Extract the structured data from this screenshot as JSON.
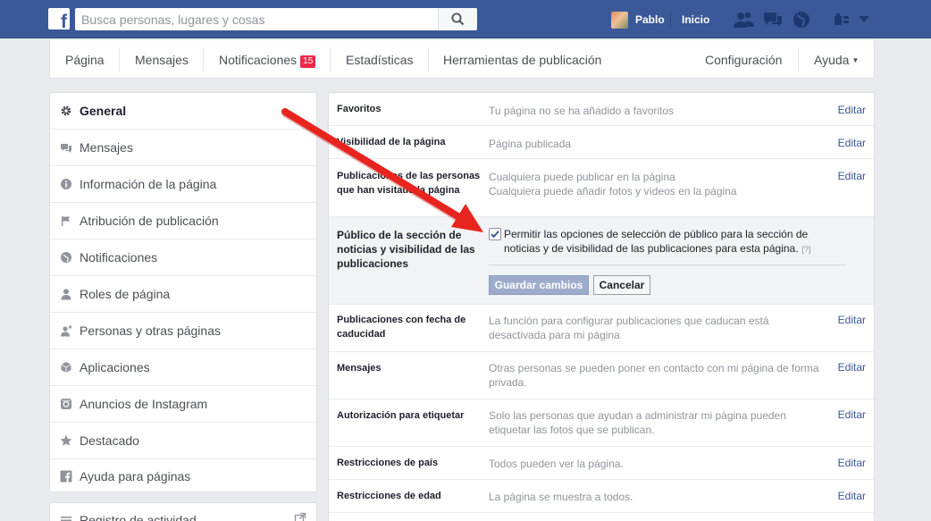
{
  "topbar": {
    "logo_letter": "f",
    "search_placeholder": "Busca personas, lugares y cosas",
    "user_name": "Pablo",
    "home_label": "Inicio"
  },
  "nav": {
    "pagina": "Página",
    "mensajes": "Mensajes",
    "notificaciones": "Notificaciones",
    "notif_count": "15",
    "estadisticas": "Estadísticas",
    "herramientas": "Herramientas de publicación",
    "configuracion": "Configuración",
    "ayuda": "Ayuda"
  },
  "sidebar": {
    "items": [
      {
        "label": "General",
        "icon": "gear-icon"
      },
      {
        "label": "Mensajes",
        "icon": "messages-icon"
      },
      {
        "label": "Información de la página",
        "icon": "info-icon"
      },
      {
        "label": "Atribución de publicación",
        "icon": "flag-icon"
      },
      {
        "label": "Notificaciones",
        "icon": "globe-icon"
      },
      {
        "label": "Roles de página",
        "icon": "person-icon"
      },
      {
        "label": "Personas y otras páginas",
        "icon": "person-star-icon"
      },
      {
        "label": "Aplicaciones",
        "icon": "cube-icon"
      },
      {
        "label": "Anuncios de Instagram",
        "icon": "instagram-icon"
      },
      {
        "label": "Destacado",
        "icon": "star-icon"
      },
      {
        "label": "Ayuda para páginas",
        "icon": "facebook-icon"
      }
    ],
    "activity_label": "Registro de actividad"
  },
  "settings": {
    "edit_label": "Editar",
    "rows": [
      {
        "label": "Favoritos",
        "value": "Tu página no se ha añadido a favoritos"
      },
      {
        "label": "Visibilidad de la página",
        "value": "Página publicada"
      },
      {
        "label": "Publicaciones de las personas que han visitado la página",
        "value": "Cualquiera puede publicar en la página",
        "value2": "Cualquiera puede añadir fotos y vídeos en la página"
      },
      {
        "label": "Publicaciones con fecha de caducidad",
        "value": "La función para configurar publicaciones que caducan está desactivada para mi página"
      },
      {
        "label": "Mensajes",
        "value": "Otras personas se pueden poner en contacto con mi página de forma privada."
      },
      {
        "label": "Autorización para etiquetar",
        "value": "Solo las personas que ayudan a administrar mi página pueden etiquetar las fotos que se publican."
      },
      {
        "label": "Restricciones de país",
        "value": "Todos pueden ver la página."
      },
      {
        "label": "Restricciones de edad",
        "value": "La página se muestra a todos."
      }
    ],
    "expanded": {
      "label": "Público de la sección de noticias y visibilidad de las publicaciones",
      "checkbox_text": "Permitir las opciones de selección de público para la sección de noticias y de visibilidad de las publicaciones para esta página.",
      "help": "[?]",
      "checked": true,
      "save_label": "Guardar cambios",
      "cancel_label": "Cancelar"
    }
  },
  "colors": {
    "brand": "#3b5998",
    "link": "#365899",
    "badge": "#f02849",
    "arrow": "#e8241f"
  }
}
